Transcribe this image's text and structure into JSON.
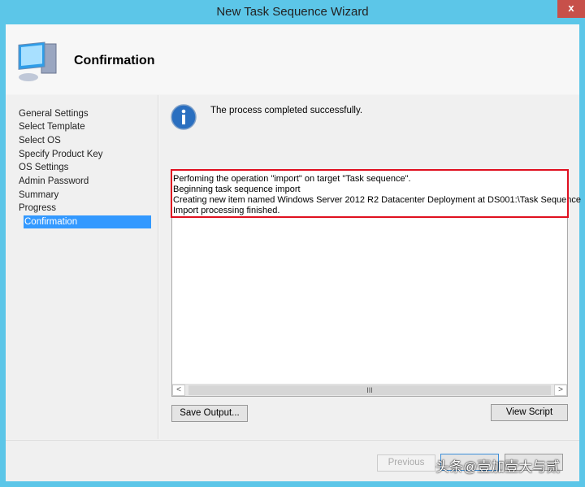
{
  "window": {
    "title": "New Task Sequence Wizard",
    "close": "x"
  },
  "header": {
    "title": "Confirmation",
    "icon": "computer-icon"
  },
  "nav": [
    "General Settings",
    "Select Template",
    "Select OS",
    "Specify Product Key",
    "OS Settings",
    "Admin Password",
    "Summary",
    "Progress",
    "Confirmation"
  ],
  "main": {
    "message": "The process completed successfully.",
    "icon": "info-icon",
    "output": [
      "Perfoming the operation \"import\" on target \"Task sequence\".",
      "Beginning task sequence import",
      "Creating new item named Windows Server 2012 R2 Datacenter Deployment at DS001:\\Task Sequence",
      "Import processing finished."
    ],
    "scroll_left": "<",
    "scroll_right": ">",
    "scroll_thumb": "III",
    "save_output": "Save Output...",
    "view_script": "View Script"
  },
  "footer": {
    "previous": "Previous"
  },
  "watermark": "头条@壹加壹大与贰"
}
